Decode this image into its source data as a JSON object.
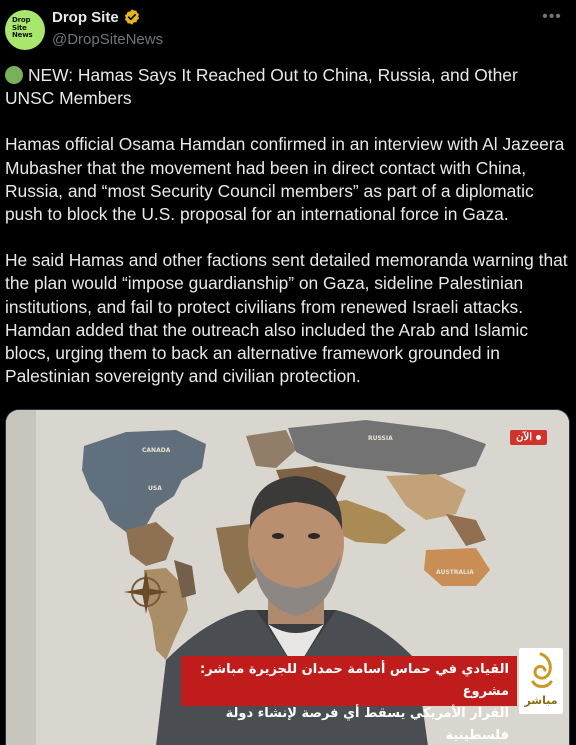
{
  "author": {
    "display_name": "Drop Site",
    "handle": "@DropSiteNews",
    "avatar_text": "Drop Site News",
    "verified": true
  },
  "post": {
    "headline": "NEW: Hamas Says It Reached Out to China, Russia, and Other UNSC Members",
    "paragraph_1": "Hamas official Osama Hamdan confirmed in an interview with Al Jazeera Mubasher that the movement had been in direct contact with China, Russia, and “most Security Council members” as part of a diplomatic push to block the U.S. proposal for an international force in Gaza.",
    "paragraph_2": "He said Hamas and other factions sent detailed memoranda warning that the plan would “impose guardianship” on Gaza, sideline Palestinian institutions, and fail to protect civilians from renewed Israeli attacks. Hamdan added that the outreach also included the Arab and Islamic blocs, urging them to back an alternative framework grounded in Palestinian sovereignty and civilian protection."
  },
  "media": {
    "live_label": "الآن",
    "caption_line_1": "القيادي في حماس أسامة حمدان للجزيرة مباشر: مشروع",
    "caption_line_2": "القرار الأمريكي يسقط أي فرصة لإنشاء دولة فلسطينية",
    "channel_label": "مباشر",
    "map_labels": [
      "CANADA",
      "RUSSIA",
      "USA",
      "AUSTRALIA"
    ]
  },
  "icons": {
    "verified": "verified-badge-icon",
    "more": "more-options-icon",
    "headline_marker": "green-circle-icon"
  },
  "colors": {
    "background": "#000000",
    "text": "#e7e9ea",
    "secondary_text": "#71767b",
    "verified": "#e2b719",
    "avatar": "#a9e66e",
    "news_red": "#c11c1c"
  }
}
